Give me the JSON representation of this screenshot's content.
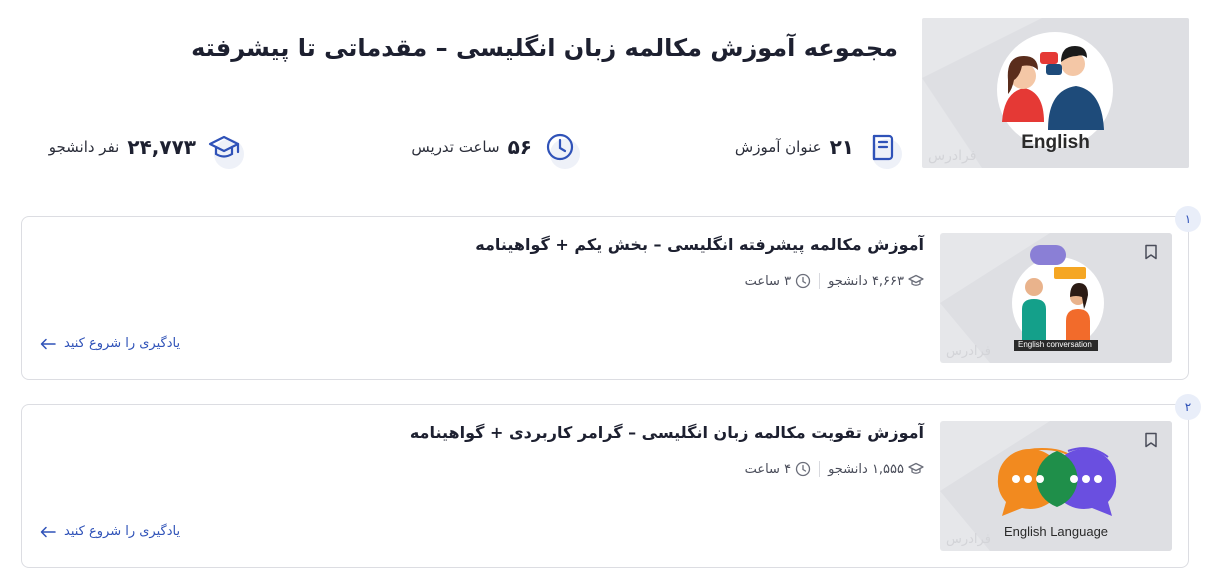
{
  "header": {
    "title": "مجموعه آموزش مکالمه زبان انگلیسی – مقدماتی تا پیشرفته",
    "image_caption": "English",
    "watermark": "فرادرس"
  },
  "stats": [
    {
      "icon": "books-icon",
      "value": "۲۱",
      "label": "عنوان آموزش"
    },
    {
      "icon": "clock-icon",
      "value": "۵۶",
      "label": "ساعت تدریس"
    },
    {
      "icon": "graduation-cap-icon",
      "value": "۲۴,۷۷۳",
      "label": "نفر دانشجو"
    }
  ],
  "courses": [
    {
      "index": "۱",
      "title": "آموزش مکالمه پیشرفته انگلیسی – بخش یکم + گواهینامه",
      "students": "۴,۶۶۳ دانشجو",
      "duration": "۳ ساعت",
      "cta": "یادگیری را شروع کنید",
      "thumb_caption": "English conversation",
      "watermark": "فرادرس"
    },
    {
      "index": "۲",
      "title": "آموزش تقویت مکالمه زبان انگلیسی – گرامر کاربردی + گواهینامه",
      "students": "۱,۵۵۵ دانشجو",
      "duration": "۴ ساعت",
      "cta": "یادگیری را شروع کنید",
      "thumb_caption": "English Language",
      "watermark": "فرادرس"
    }
  ],
  "colors": {
    "accent": "#2f52b8",
    "text": "#1d2030",
    "border": "#dcdde2",
    "thumb_bg": "#e6e7ea"
  }
}
